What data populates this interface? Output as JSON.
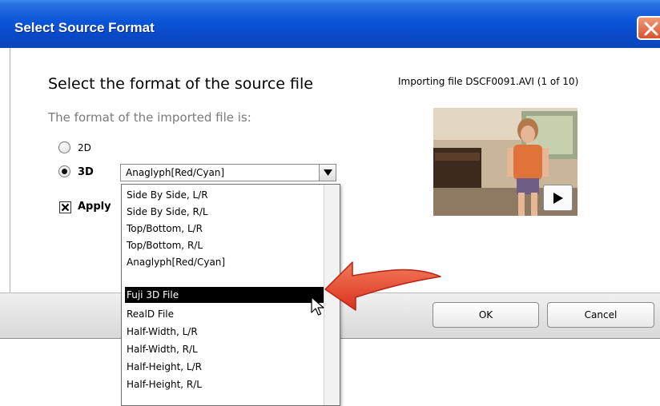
{
  "window": {
    "title": "Select Source Format",
    "title_color": "#0a55d8",
    "close_icon": "close-icon"
  },
  "main": {
    "heading": "Select the format of the source file",
    "subheading": "The format of the imported file is:",
    "options": {
      "radio_2d": {
        "label": "2D",
        "selected": false
      },
      "radio_3d": {
        "label": "3D",
        "selected": true
      }
    },
    "format_select": {
      "value": "Anaglyph[Red/Cyan]",
      "arrow_icon": "chevron-down-icon"
    },
    "apply_checkbox": {
      "label": "Apply",
      "checked": true
    }
  },
  "preview": {
    "importing_text": "Importing file DSCF0091.AVI (1 of 10)",
    "play_icon": "play-icon"
  },
  "dropdown": {
    "items": [
      "Side By Side, L/R",
      "Side By Side, R/L",
      "Top/Bottom, L/R",
      "Top/Bottom, R/L",
      "Anaglyph[Red/Cyan]",
      "Fuji 3D File",
      "RealD File",
      "Half-Width, L/R",
      "Half-Width, R/L",
      "Half-Height, L/R",
      "Half-Height, R/L"
    ],
    "highlighted_item": "Fuji 3D File"
  },
  "footer": {
    "ok_label": "OK",
    "cancel_label": "Cancel"
  },
  "annotation": {
    "arrow_color": "#e8452c",
    "cursor_icon": "mouse-cursor-icon"
  }
}
